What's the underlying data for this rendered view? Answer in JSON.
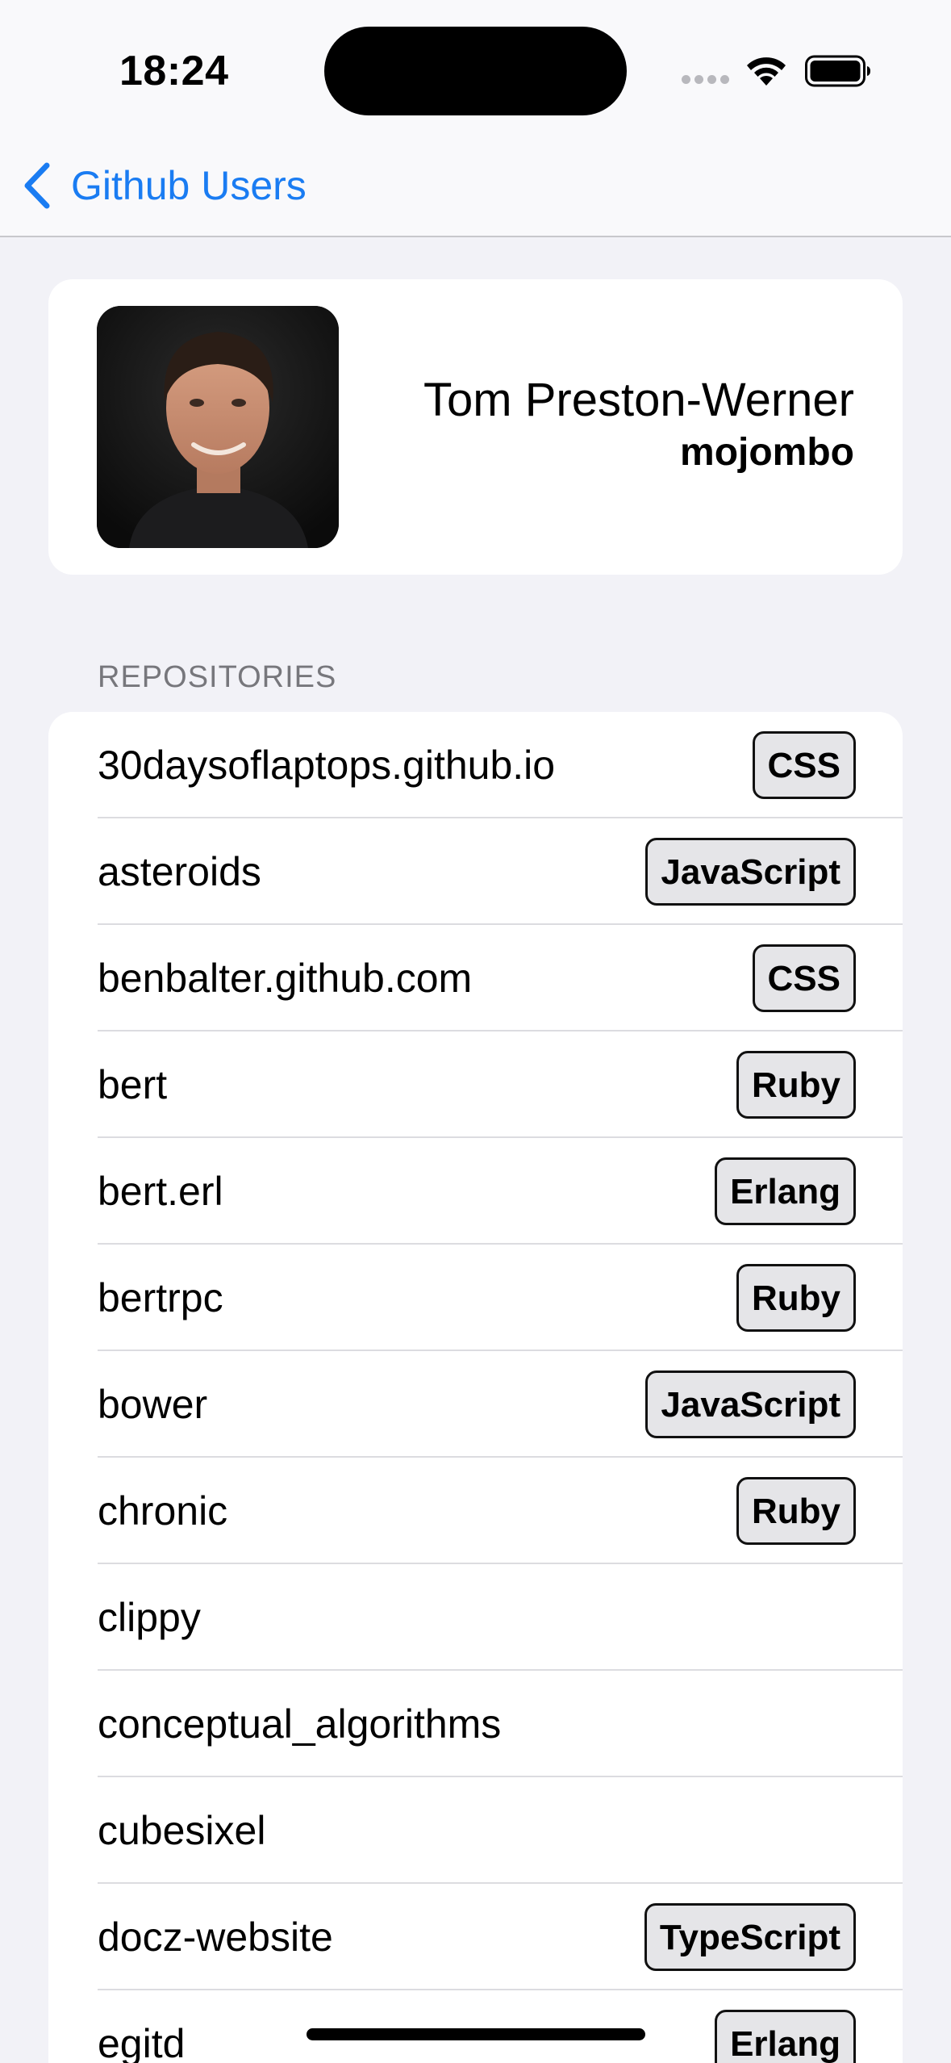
{
  "status_bar": {
    "time": "18:24",
    "signal_icon": "signal-dots-icon",
    "wifi_icon": "wifi-icon",
    "battery_icon": "battery-full-icon"
  },
  "nav": {
    "back_icon": "chevron-left-icon",
    "back_label": "Github Users"
  },
  "profile": {
    "name": "Tom Preston-Werner",
    "login": "mojombo",
    "avatar_icon": "avatar-photo"
  },
  "repositories": {
    "header": "REPOSITORIES",
    "items": [
      {
        "name": "30daysoflaptops.github.io",
        "language": "CSS"
      },
      {
        "name": "asteroids",
        "language": "JavaScript"
      },
      {
        "name": "benbalter.github.com",
        "language": "CSS"
      },
      {
        "name": "bert",
        "language": "Ruby"
      },
      {
        "name": "bert.erl",
        "language": "Erlang"
      },
      {
        "name": "bertrpc",
        "language": "Ruby"
      },
      {
        "name": "bower",
        "language": "JavaScript"
      },
      {
        "name": "chronic",
        "language": "Ruby"
      },
      {
        "name": "clippy",
        "language": ""
      },
      {
        "name": "conceptual_algorithms",
        "language": ""
      },
      {
        "name": "cubesixel",
        "language": ""
      },
      {
        "name": "docz-website",
        "language": "TypeScript"
      },
      {
        "name": "egitd",
        "language": "Erlang"
      }
    ]
  },
  "colors": {
    "accent": "#1a7cf2",
    "background": "#f2f2f7",
    "card": "#ffffff",
    "badge_fill": "#e5e5e8",
    "secondary_text": "#77777c"
  }
}
